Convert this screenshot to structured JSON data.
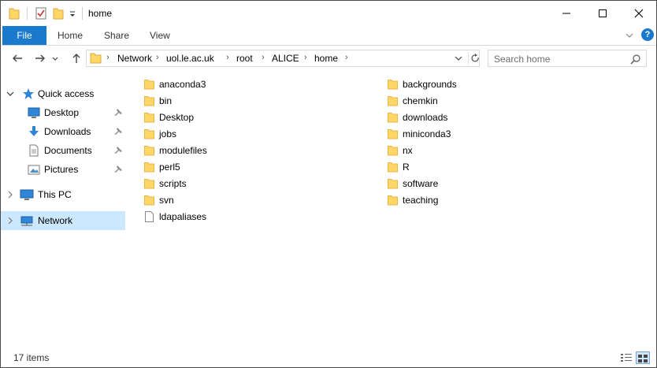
{
  "window": {
    "title": "home"
  },
  "ribbon": {
    "file_tab": "File",
    "tabs": [
      "Home",
      "Share",
      "View"
    ],
    "help_label": "?"
  },
  "address": {
    "breadcrumbs": [
      "Network",
      "uol.le.ac.uk",
      "root",
      "ALICE",
      "home"
    ],
    "search_placeholder": "Search home"
  },
  "nav": {
    "quick_access": "Quick access",
    "quick_items": [
      {
        "label": "Desktop",
        "icon": "desktop-icon",
        "pinned": true
      },
      {
        "label": "Downloads",
        "icon": "downloads-icon",
        "pinned": true
      },
      {
        "label": "Documents",
        "icon": "documents-icon",
        "pinned": true
      },
      {
        "label": "Pictures",
        "icon": "pictures-icon",
        "pinned": true
      }
    ],
    "this_pc": "This PC",
    "network": "Network"
  },
  "files": {
    "column1": [
      {
        "name": "anaconda3",
        "type": "folder"
      },
      {
        "name": "bin",
        "type": "folder"
      },
      {
        "name": "Desktop",
        "type": "folder"
      },
      {
        "name": "jobs",
        "type": "folder"
      },
      {
        "name": "modulefiles",
        "type": "folder"
      },
      {
        "name": "perl5",
        "type": "folder"
      },
      {
        "name": "scripts",
        "type": "folder"
      },
      {
        "name": "svn",
        "type": "folder"
      },
      {
        "name": "ldapaliases",
        "type": "file"
      }
    ],
    "column2": [
      {
        "name": "backgrounds",
        "type": "folder"
      },
      {
        "name": "chemkin",
        "type": "folder"
      },
      {
        "name": "downloads",
        "type": "folder"
      },
      {
        "name": "miniconda3",
        "type": "folder"
      },
      {
        "name": "nx",
        "type": "folder"
      },
      {
        "name": "R",
        "type": "folder"
      },
      {
        "name": "software",
        "type": "folder"
      },
      {
        "name": "teaching",
        "type": "folder"
      }
    ]
  },
  "status": {
    "item_count": "17 items"
  },
  "colors": {
    "accent": "#1979ca",
    "folder": "#ffd766",
    "folder_dark": "#e8b64a",
    "selected": "#cce8ff"
  }
}
